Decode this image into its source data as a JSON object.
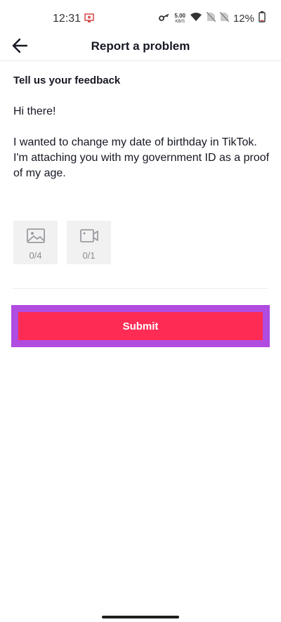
{
  "status_bar": {
    "time": "12:31",
    "speed_value": "5.00",
    "speed_unit": "KB/S",
    "battery": "12%",
    "icons": [
      "screen-record-icon",
      "key-icon",
      "wifi-icon",
      "no-sim-icon",
      "battery-icon"
    ]
  },
  "header": {
    "title": "Report a problem",
    "back_icon": "back-arrow-icon"
  },
  "form": {
    "heading": "Tell us your feedback",
    "feedback_text": "Hi there!\n\nI wanted to change my date of birthday in TikTok. I'm attaching you with my government ID as a proof of my age.",
    "attachments": [
      {
        "icon": "image-icon",
        "count": "0/4"
      },
      {
        "icon": "video-icon",
        "count": "0/1"
      }
    ],
    "submit_label": "Submit"
  },
  "colors": {
    "accent": "#fe2c55",
    "highlight_border": "#b04ce0",
    "attachment_bg": "#f1f1f2"
  }
}
